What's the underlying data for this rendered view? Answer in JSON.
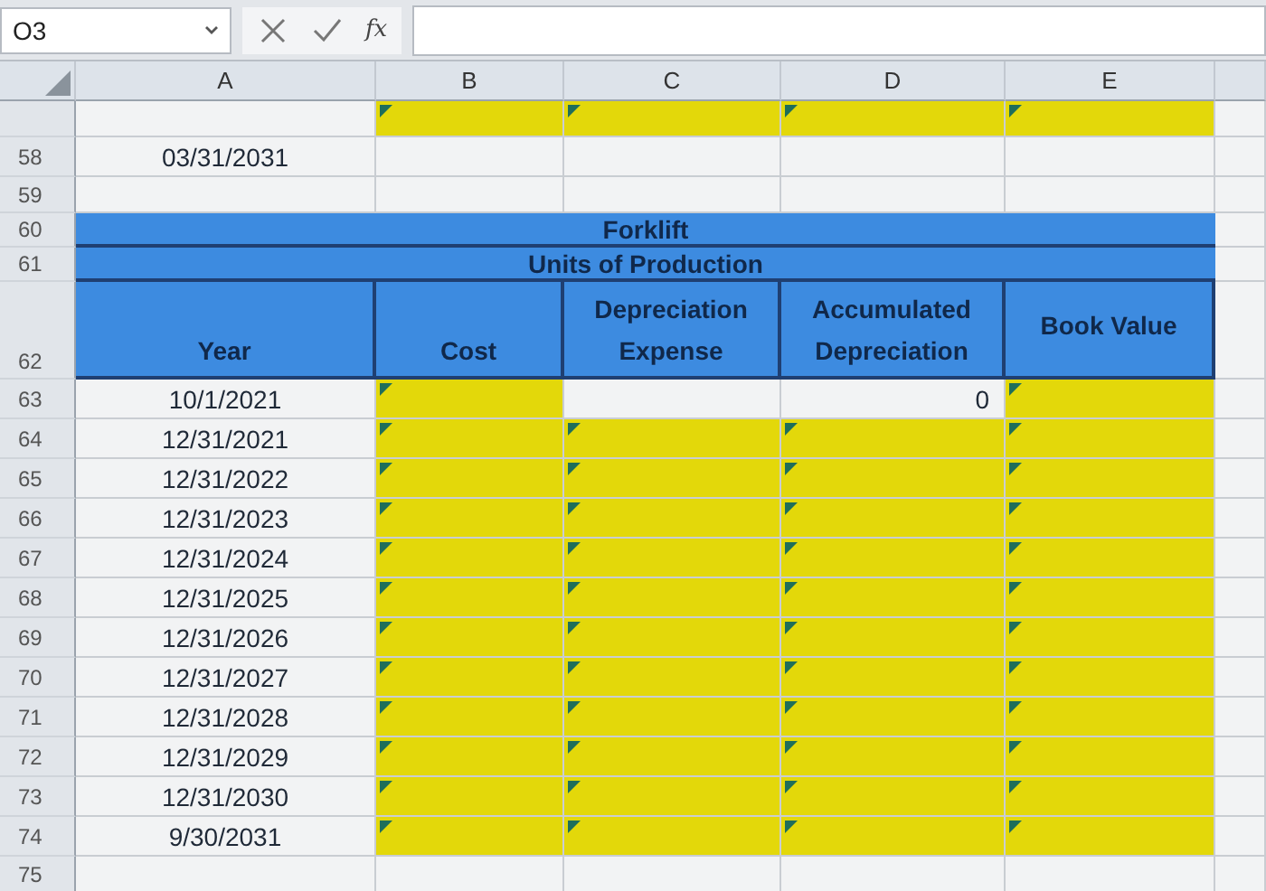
{
  "name_box": {
    "value": "O3"
  },
  "formula_bar": {
    "function_label": "fx"
  },
  "columns": [
    "A",
    "B",
    "C",
    "D",
    "E"
  ],
  "rows": [
    {
      "kind": "data",
      "cells": [
        {
          "highlighted": false,
          "flagged": false
        },
        {
          "highlighted": true,
          "flagged": true
        },
        {
          "highlighted": true,
          "flagged": true
        },
        {
          "highlighted": true,
          "flagged": true
        },
        {
          "highlighted": true,
          "flagged": true
        }
      ]
    },
    {
      "kind": "data",
      "number": "58",
      "cells": [
        {
          "text": "03/31/2031",
          "highlighted": false,
          "flagged": false
        },
        {
          "highlighted": false,
          "flagged": false
        },
        {
          "highlighted": false,
          "flagged": false
        },
        {
          "highlighted": false,
          "flagged": false
        },
        {
          "highlighted": false,
          "flagged": false
        }
      ]
    },
    {
      "kind": "blank",
      "number": "59"
    },
    {
      "kind": "band",
      "number": "60",
      "text": "Forklift"
    },
    {
      "kind": "band",
      "number": "61",
      "text": "Units of Production"
    },
    {
      "kind": "header",
      "number": "62",
      "cells": [
        "Year",
        "Cost",
        "Depreciation Expense",
        "Accumulated Depreciation",
        "Book Value"
      ]
    },
    {
      "kind": "data",
      "number": "63",
      "cells": [
        {
          "text": "10/1/2021",
          "highlighted": false,
          "flagged": false
        },
        {
          "highlighted": true,
          "flagged": true
        },
        {
          "highlighted": false,
          "flagged": false
        },
        {
          "text": "0",
          "highlighted": false,
          "flagged": false
        },
        {
          "highlighted": true,
          "flagged": true
        }
      ]
    },
    {
      "kind": "data",
      "number": "64",
      "cells": [
        {
          "text": "12/31/2021",
          "highlighted": false,
          "flagged": false
        },
        {
          "highlighted": true,
          "flagged": true
        },
        {
          "highlighted": true,
          "flagged": true
        },
        {
          "highlighted": true,
          "flagged": true
        },
        {
          "highlighted": true,
          "flagged": true
        }
      ]
    },
    {
      "kind": "data",
      "number": "65",
      "cells": [
        {
          "text": "12/31/2022",
          "highlighted": false,
          "flagged": false
        },
        {
          "highlighted": true,
          "flagged": true
        },
        {
          "highlighted": true,
          "flagged": true
        },
        {
          "highlighted": true,
          "flagged": true
        },
        {
          "highlighted": true,
          "flagged": true
        }
      ]
    },
    {
      "kind": "data",
      "number": "66",
      "cells": [
        {
          "text": "12/31/2023",
          "highlighted": false,
          "flagged": false
        },
        {
          "highlighted": true,
          "flagged": true
        },
        {
          "highlighted": true,
          "flagged": true
        },
        {
          "highlighted": true,
          "flagged": true
        },
        {
          "highlighted": true,
          "flagged": true
        }
      ]
    },
    {
      "kind": "data",
      "number": "67",
      "cells": [
        {
          "text": "12/31/2024",
          "highlighted": false,
          "flagged": false
        },
        {
          "highlighted": true,
          "flagged": true
        },
        {
          "highlighted": true,
          "flagged": true
        },
        {
          "highlighted": true,
          "flagged": true
        },
        {
          "highlighted": true,
          "flagged": true
        }
      ]
    },
    {
      "kind": "data",
      "number": "68",
      "cells": [
        {
          "text": "12/31/2025",
          "highlighted": false,
          "flagged": false
        },
        {
          "highlighted": true,
          "flagged": true
        },
        {
          "highlighted": true,
          "flagged": true
        },
        {
          "highlighted": true,
          "flagged": true
        },
        {
          "highlighted": true,
          "flagged": true
        }
      ]
    },
    {
      "kind": "data",
      "number": "69",
      "cells": [
        {
          "text": "12/31/2026",
          "highlighted": false,
          "flagged": false
        },
        {
          "highlighted": true,
          "flagged": true
        },
        {
          "highlighted": true,
          "flagged": true
        },
        {
          "highlighted": true,
          "flagged": true
        },
        {
          "highlighted": true,
          "flagged": true
        }
      ]
    },
    {
      "kind": "data",
      "number": "70",
      "cells": [
        {
          "text": "12/31/2027",
          "highlighted": false,
          "flagged": false
        },
        {
          "highlighted": true,
          "flagged": true
        },
        {
          "highlighted": true,
          "flagged": true
        },
        {
          "highlighted": true,
          "flagged": true
        },
        {
          "highlighted": true,
          "flagged": true
        }
      ]
    },
    {
      "kind": "data",
      "number": "71",
      "cells": [
        {
          "text": "12/31/2028",
          "highlighted": false,
          "flagged": false
        },
        {
          "highlighted": true,
          "flagged": true
        },
        {
          "highlighted": true,
          "flagged": true
        },
        {
          "highlighted": true,
          "flagged": true
        },
        {
          "highlighted": true,
          "flagged": true
        }
      ]
    },
    {
      "kind": "data",
      "number": "72",
      "cells": [
        {
          "text": "12/31/2029",
          "highlighted": false,
          "flagged": false
        },
        {
          "highlighted": true,
          "flagged": true
        },
        {
          "highlighted": true,
          "flagged": true
        },
        {
          "highlighted": true,
          "flagged": true
        },
        {
          "highlighted": true,
          "flagged": true
        }
      ]
    },
    {
      "kind": "data",
      "number": "73",
      "cells": [
        {
          "text": "12/31/2030",
          "highlighted": false,
          "flagged": false
        },
        {
          "highlighted": true,
          "flagged": true
        },
        {
          "highlighted": true,
          "flagged": true
        },
        {
          "highlighted": true,
          "flagged": true
        },
        {
          "highlighted": true,
          "flagged": true
        }
      ]
    },
    {
      "kind": "data",
      "number": "74",
      "cells": [
        {
          "text": "9/30/2031",
          "highlighted": false,
          "flagged": false
        },
        {
          "highlighted": true,
          "flagged": true
        },
        {
          "highlighted": true,
          "flagged": true
        },
        {
          "highlighted": true,
          "flagged": true
        },
        {
          "highlighted": true,
          "flagged": true
        }
      ]
    },
    {
      "kind": "blank",
      "number": "75"
    }
  ]
}
